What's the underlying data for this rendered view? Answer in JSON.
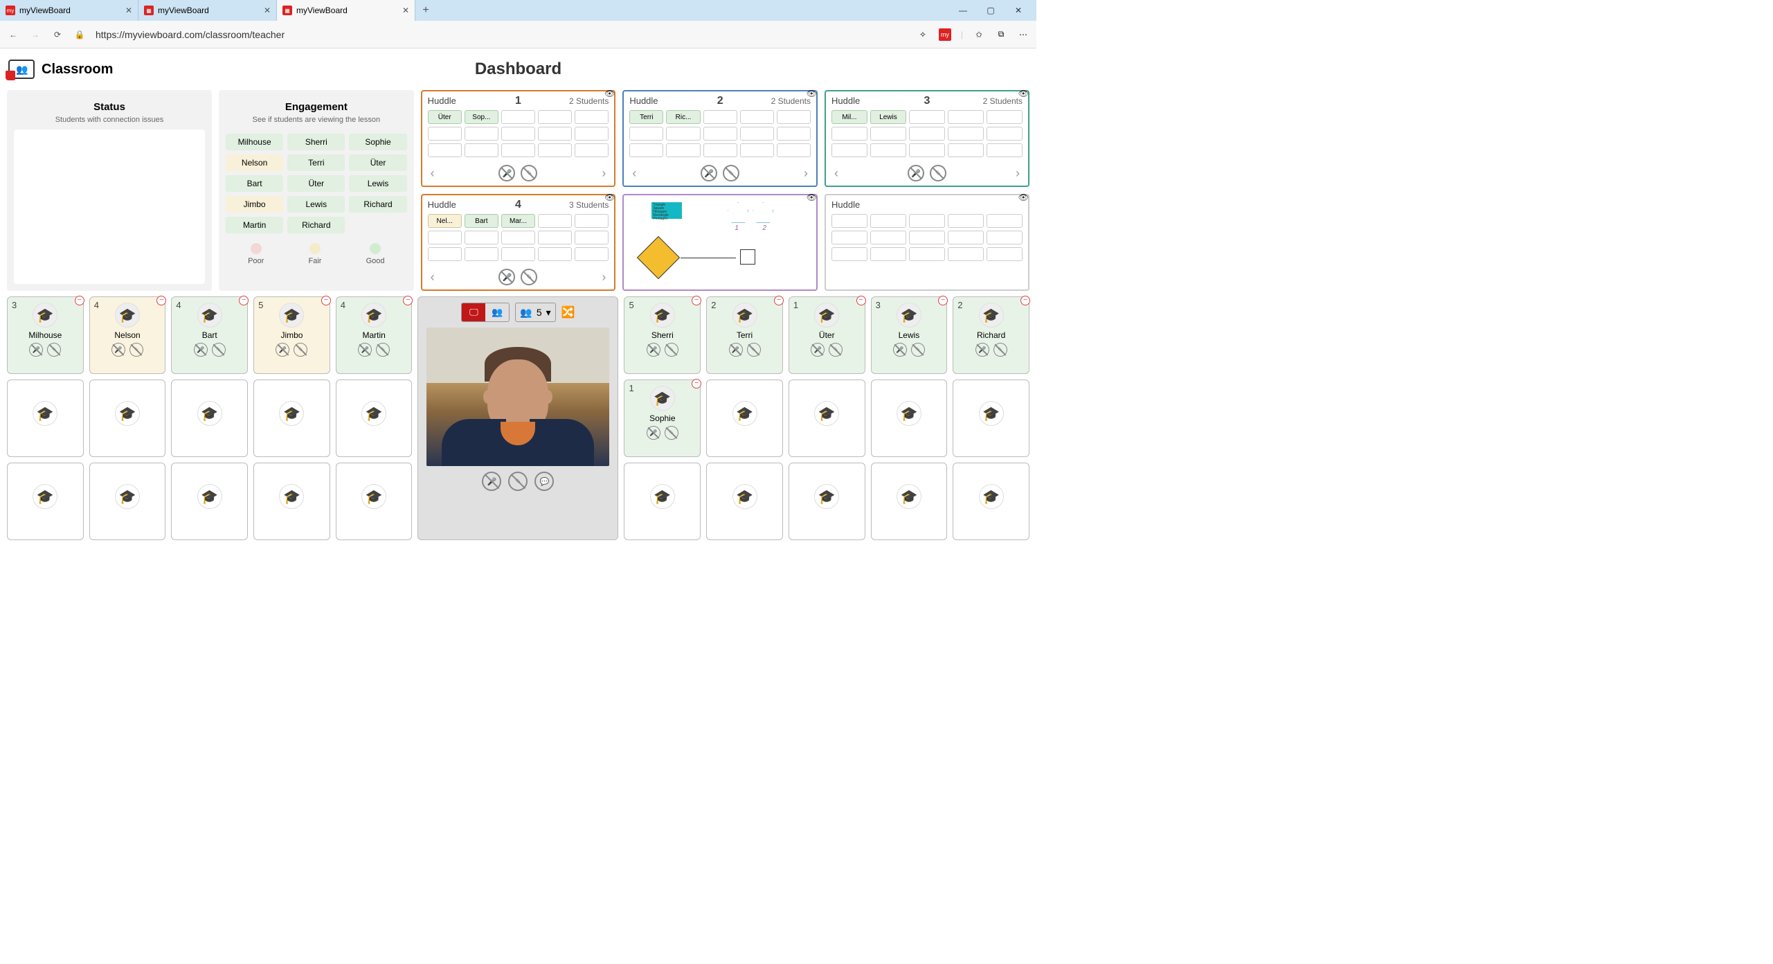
{
  "browser": {
    "tabs": [
      {
        "title": "myViewBoard",
        "active": false
      },
      {
        "title": "myViewBoard",
        "active": false
      },
      {
        "title": "myViewBoard",
        "active": true
      }
    ],
    "url": "https://myviewboard.com/classroom/teacher"
  },
  "header": {
    "app": "Classroom",
    "page_title": "Dashboard"
  },
  "status": {
    "title": "Status",
    "sub": "Students with connection issues"
  },
  "engagement": {
    "title": "Engagement",
    "sub": "See if students are viewing the lesson",
    "chips": [
      {
        "name": "Milhouse",
        "lvl": "good"
      },
      {
        "name": "Sherri",
        "lvl": "good"
      },
      {
        "name": "Sophie",
        "lvl": "good"
      },
      {
        "name": "Nelson",
        "lvl": "fair"
      },
      {
        "name": "Terri",
        "lvl": "good"
      },
      {
        "name": "Üter",
        "lvl": "good"
      },
      {
        "name": "Bart",
        "lvl": "good"
      },
      {
        "name": "Üter",
        "lvl": "good"
      },
      {
        "name": "Lewis",
        "lvl": "good"
      },
      {
        "name": "Jimbo",
        "lvl": "fair"
      },
      {
        "name": "Lewis",
        "lvl": "good"
      },
      {
        "name": "Richard",
        "lvl": "good"
      },
      {
        "name": "Martin",
        "lvl": "good"
      },
      {
        "name": "Richard",
        "lvl": "good"
      }
    ],
    "legend": {
      "poor": "Poor",
      "fair": "Fair",
      "good": "Good"
    }
  },
  "huddles": [
    {
      "label": "Huddle",
      "num": "1",
      "count": "2 Students",
      "color": "orange",
      "slots": [
        {
          "t": "Üter",
          "f": "good"
        },
        {
          "t": "Sop...",
          "f": "good"
        }
      ]
    },
    {
      "label": "Huddle",
      "num": "2",
      "count": "2 Students",
      "color": "blue",
      "slots": [
        {
          "t": "Terri",
          "f": "good"
        },
        {
          "t": "Ric...",
          "f": "good"
        }
      ]
    },
    {
      "label": "Huddle",
      "num": "3",
      "count": "2 Students",
      "color": "teal",
      "slots": [
        {
          "t": "Mil...",
          "f": "good"
        },
        {
          "t": "Lewis",
          "f": "good"
        }
      ]
    },
    {
      "label": "Huddle",
      "num": "4",
      "count": "3 Students",
      "color": "orange",
      "slots": [
        {
          "t": "Nel...",
          "f": "fair"
        },
        {
          "t": "Bart",
          "f": "good"
        },
        {
          "t": "Mar...",
          "f": "good"
        }
      ]
    },
    {
      "label": "",
      "num": "",
      "count": "",
      "color": "purple",
      "canvas": true
    },
    {
      "label": "Huddle",
      "num": "",
      "count": "",
      "color": "gray",
      "slots": [],
      "nctrl": true
    }
  ],
  "teacher": {
    "group_size": "5"
  },
  "students_row1_left": [
    {
      "n": "3",
      "name": "Milhouse",
      "bg": "good"
    },
    {
      "n": "4",
      "name": "Nelson",
      "bg": "fair"
    },
    {
      "n": "4",
      "name": "Bart",
      "bg": "good"
    },
    {
      "n": "5",
      "name": "Jimbo",
      "bg": "fair"
    },
    {
      "n": "4",
      "name": "Martin",
      "bg": "good"
    }
  ],
  "students_row1_right": [
    {
      "n": "5",
      "name": "Sherri",
      "bg": "good"
    },
    {
      "n": "2",
      "name": "Terri",
      "bg": "good"
    },
    {
      "n": "1",
      "name": "Üter",
      "bg": "good"
    },
    {
      "n": "3",
      "name": "Lewis",
      "bg": "good"
    },
    {
      "n": "2",
      "name": "Richard",
      "bg": "good"
    }
  ],
  "students_row2_right_first": {
    "n": "1",
    "name": "Sophie",
    "bg": "good"
  },
  "canvas_note": "Triangle\nSquare\nHexagon\nRectangle\nPentagon"
}
